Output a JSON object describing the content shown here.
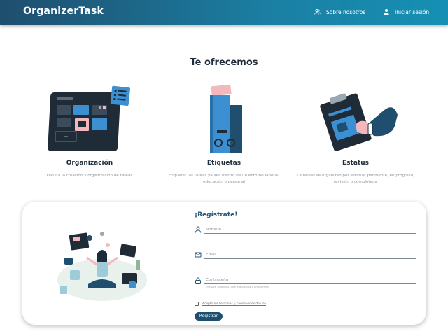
{
  "navbar": {
    "brand": "OrganizerTask",
    "links": [
      {
        "label": "Sobre nosotros",
        "icon": "users-icon"
      },
      {
        "label": "Iniciar sesión",
        "icon": "user-icon"
      }
    ]
  },
  "offer": {
    "title": "Te ofrecemos",
    "features": [
      {
        "title": "Organización",
        "description": "Facilita la creación y organización de tareas",
        "icon": "dashboard-illustration"
      },
      {
        "title": "Etiquetas",
        "description": "Etiquetar las tareas ya sea dentro de un entorno laboral, educación o personal",
        "icon": "binders-illustration"
      },
      {
        "title": "Estatus",
        "description": "La tareas se organizan por estatus: pendiente, en progreso, revisión o completada",
        "icon": "clipboard-illustration"
      }
    ]
  },
  "register": {
    "title": "¡Regístrate!",
    "fields": [
      {
        "placeholder": "Nombre",
        "icon": "user-icon"
      },
      {
        "placeholder": "Email",
        "icon": "mail-icon"
      },
      {
        "placeholder": "Contraseña",
        "icon": "lock-icon",
        "hint": "(Incluye símbolos, una mayúscula y un número)"
      }
    ],
    "terms": "Acepto los términos y condiciones de uso",
    "submit": "Registrar"
  },
  "colors": {
    "primary": "#1e4f70",
    "accent": "#1b7fa3",
    "pink": "#f3b8bd"
  }
}
